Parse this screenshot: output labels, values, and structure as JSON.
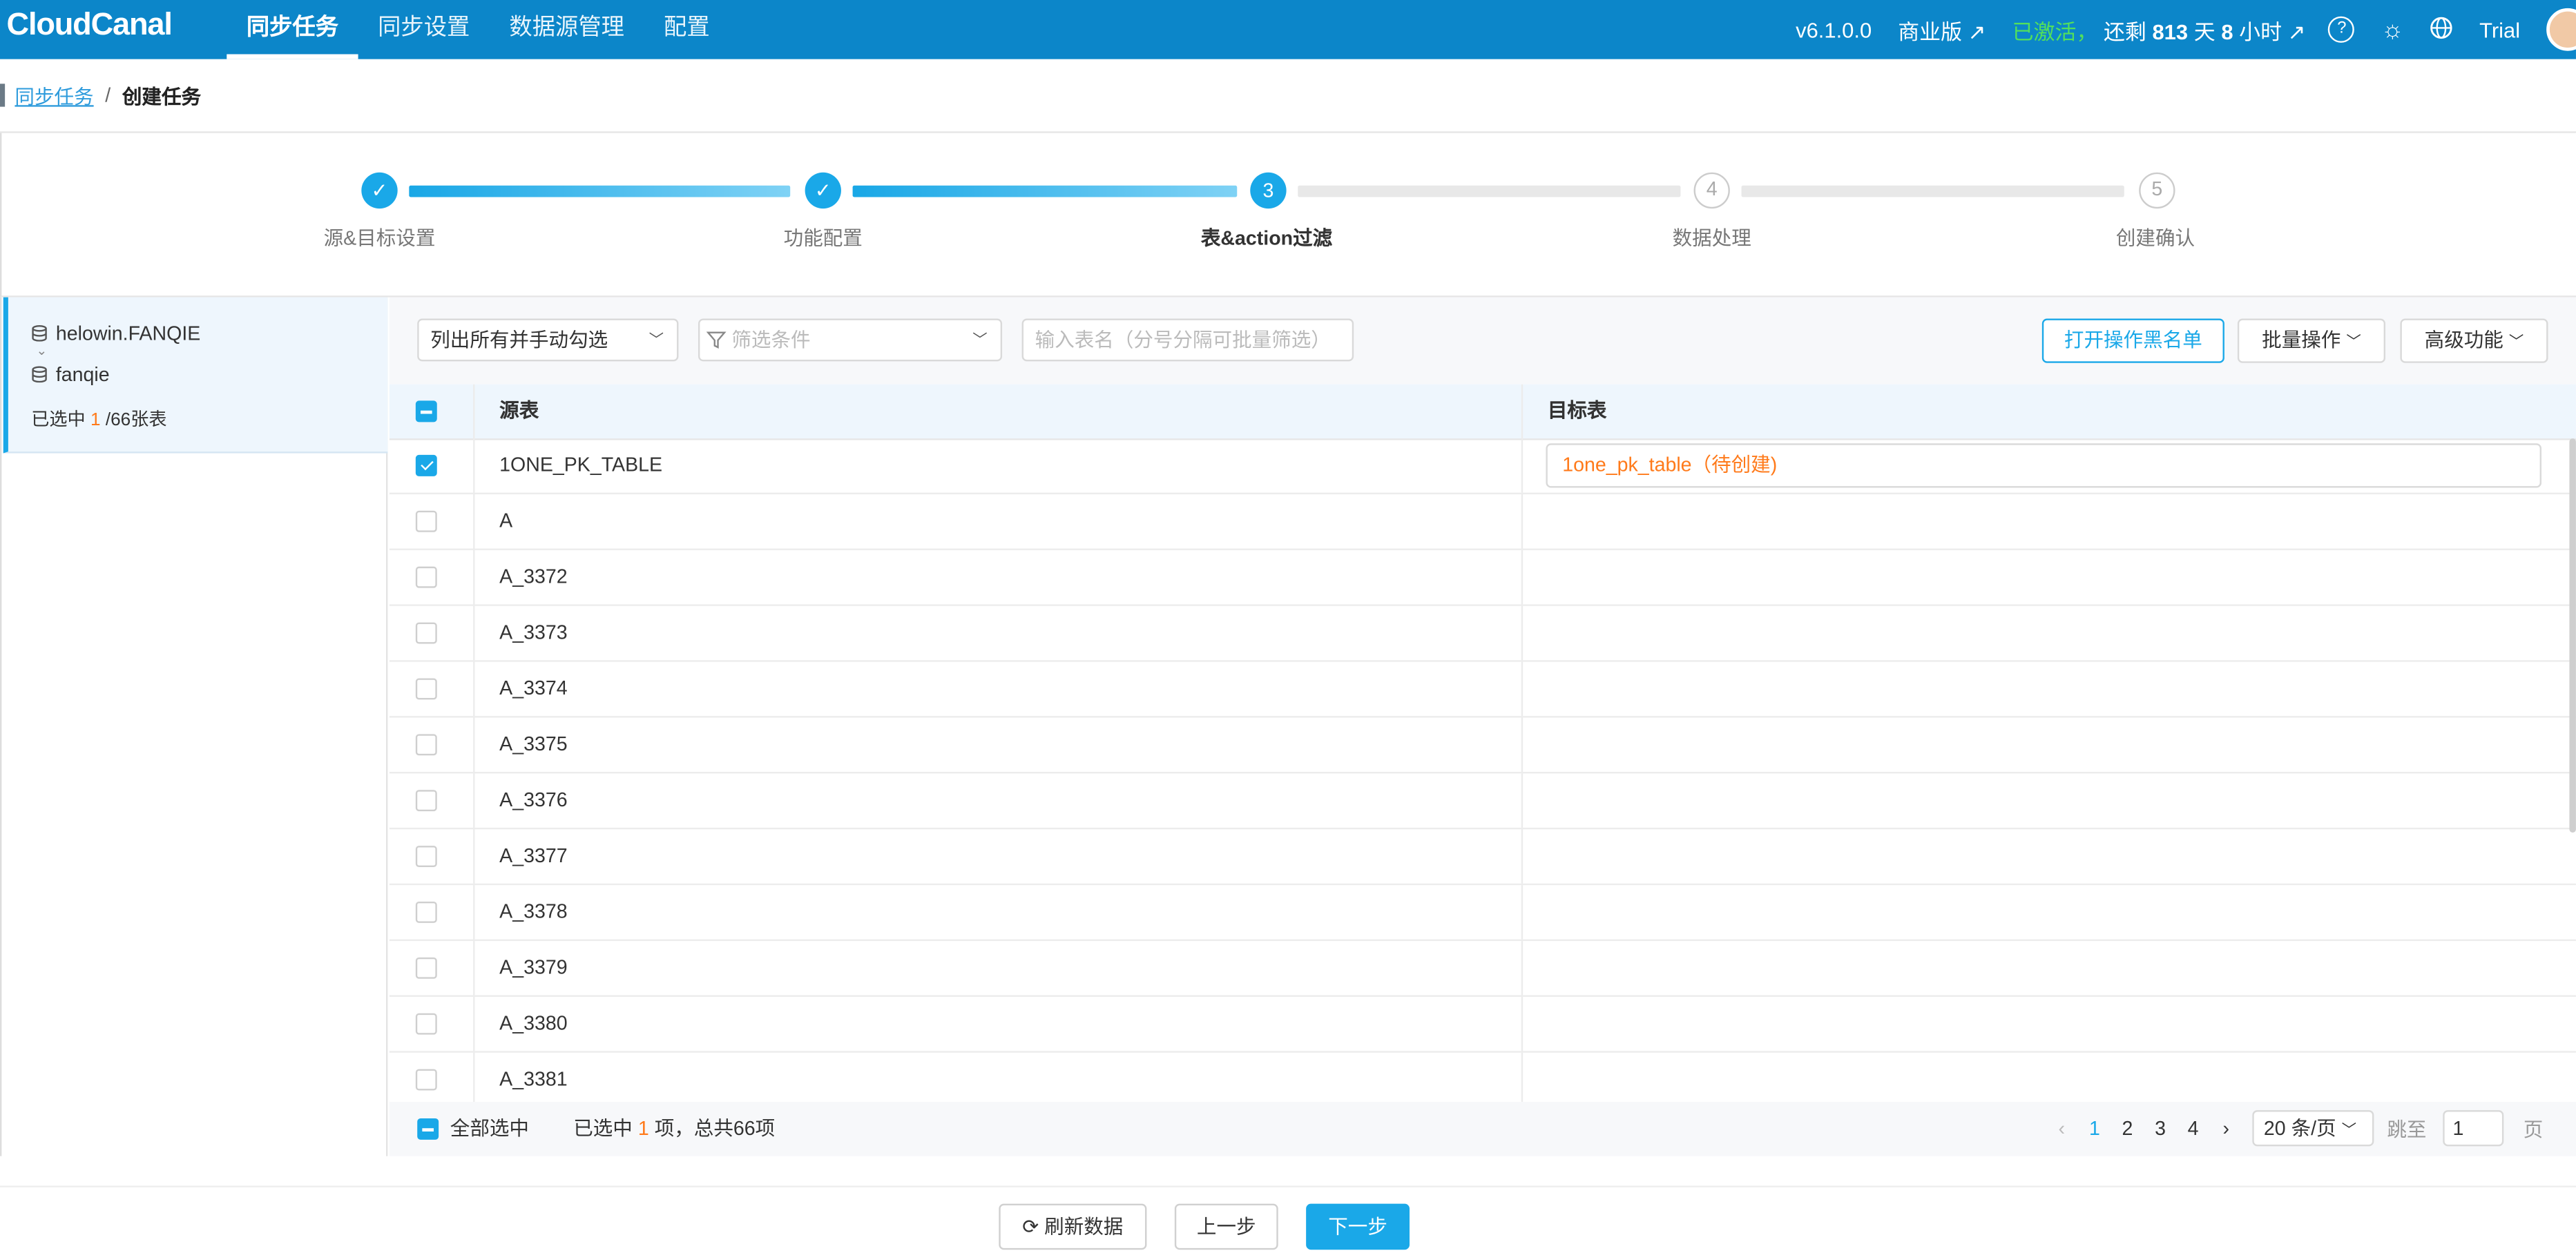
{
  "app": {
    "logo": "CloudCanal"
  },
  "nav": {
    "items": [
      {
        "label": "同步任务"
      },
      {
        "label": "同步设置"
      },
      {
        "label": "数据源管理"
      },
      {
        "label": "配置"
      }
    ],
    "version": "v6.1.0.0",
    "edition": "商业版 ↗",
    "activated": "已激活，",
    "license_prefix": "还剩",
    "license_days": "813",
    "license_days_unit": "天",
    "license_hours": "8",
    "license_hours_unit": "小时 ↗",
    "user": "Trial"
  },
  "breadcrumb": {
    "parent": "同步任务",
    "separator": "/",
    "current": "创建任务"
  },
  "steps": [
    {
      "label": "源&目标设置",
      "status": "done",
      "symbol": "✓"
    },
    {
      "label": "功能配置",
      "status": "done",
      "symbol": "✓"
    },
    {
      "label": "表&action过滤",
      "status": "current",
      "symbol": "3"
    },
    {
      "label": "数据处理",
      "status": "todo",
      "symbol": "4"
    },
    {
      "label": "创建确认",
      "status": "todo",
      "symbol": "5"
    }
  ],
  "left": {
    "source_db": "helowin.FANQIE",
    "target_db": "fanqie",
    "selected_prefix": "已选中",
    "selected_count": "1",
    "selected_suffix": "/66张表"
  },
  "toolbar": {
    "mode_select": "列出所有并手动勾选",
    "filter_placeholder": "筛选条件",
    "table_search_placeholder": "输入表名（分号分隔可批量筛选）",
    "blacklist_button": "打开操作黑名单",
    "batch_button": "批量操作",
    "advanced_button": "高级功能"
  },
  "table": {
    "header_source": "源表",
    "header_target": "目标表",
    "rows": [
      {
        "source": "1ONE_PK_TABLE",
        "target": "1one_pk_table（待创建)",
        "checked": true
      },
      {
        "source": "A",
        "target": "",
        "checked": false
      },
      {
        "source": "A_3372",
        "target": "",
        "checked": false
      },
      {
        "source": "A_3373",
        "target": "",
        "checked": false
      },
      {
        "source": "A_3374",
        "target": "",
        "checked": false
      },
      {
        "source": "A_3375",
        "target": "",
        "checked": false
      },
      {
        "source": "A_3376",
        "target": "",
        "checked": false
      },
      {
        "source": "A_3377",
        "target": "",
        "checked": false
      },
      {
        "source": "A_3378",
        "target": "",
        "checked": false
      },
      {
        "source": "A_3379",
        "target": "",
        "checked": false
      },
      {
        "source": "A_3380",
        "target": "",
        "checked": false
      },
      {
        "source": "A_3381",
        "target": "",
        "checked": false
      }
    ]
  },
  "footer": {
    "select_all": "全部选中",
    "summary_prefix": "已选中",
    "summary_count": "1",
    "summary_suffix": "项，总共66项",
    "pages": [
      "1",
      "2",
      "3",
      "4"
    ],
    "current_page": "1",
    "page_size": "20 条/页",
    "jump_label": "跳至",
    "jump_value": "1",
    "page_unit": "页"
  },
  "actions": {
    "refresh": "刷新数据",
    "prev": "上一步",
    "next": "下一步"
  },
  "colors": {
    "brand": "#0c86c9",
    "accent": "#1aa8e8",
    "orange": "#ff7a1a",
    "activated": "#52e05c"
  }
}
